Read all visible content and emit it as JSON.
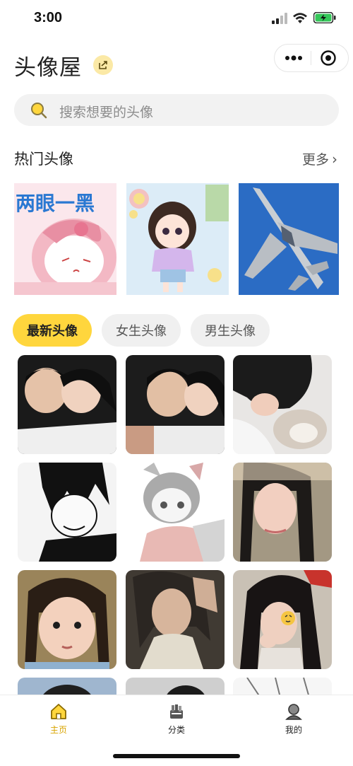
{
  "status_bar": {
    "time": "3:00"
  },
  "header": {
    "title": "头像屋"
  },
  "search": {
    "placeholder": "搜索想要的头像"
  },
  "hot_section": {
    "title": "热门头像",
    "more_label": "更多",
    "cards": [
      {
        "overlay_text": "两眼一黑"
      }
    ]
  },
  "tabs": [
    {
      "label": "最新头像",
      "active": true
    },
    {
      "label": "女生头像",
      "active": false
    },
    {
      "label": "男生头像",
      "active": false
    }
  ],
  "bottom_nav": [
    {
      "label": "主页",
      "icon": "home-icon",
      "active": true
    },
    {
      "label": "分类",
      "icon": "category-icon",
      "active": false
    },
    {
      "label": "我的",
      "icon": "profile-icon",
      "active": false
    }
  ],
  "colors": {
    "accent": "#ffd63d",
    "active_nav": "#d9a400"
  }
}
